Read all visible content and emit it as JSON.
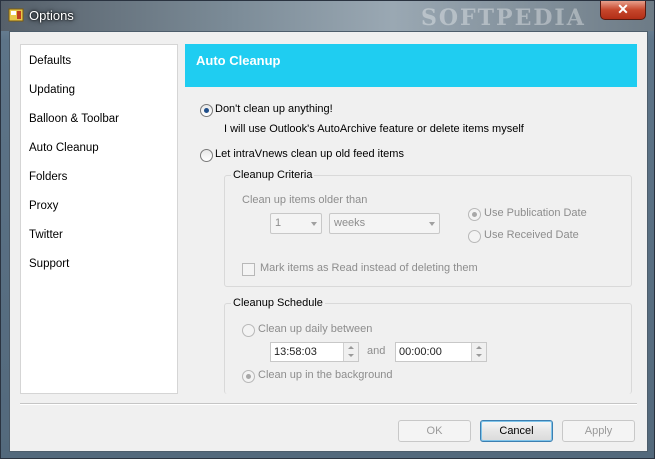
{
  "window": {
    "title": "Options",
    "watermark": "SOFTPEDIA",
    "close_glyph": "✕"
  },
  "sidebar": {
    "items": [
      {
        "label": "Defaults"
      },
      {
        "label": "Updating"
      },
      {
        "label": "Balloon & Toolbar"
      },
      {
        "label": "Auto Cleanup"
      },
      {
        "label": "Folders"
      },
      {
        "label": "Proxy"
      },
      {
        "label": "Twitter"
      },
      {
        "label": "Support"
      }
    ]
  },
  "panel": {
    "title": "Auto Cleanup",
    "header_color": "#1fcdf1",
    "options": {
      "no_cleanup_label": "Don't clean up anything!",
      "no_cleanup_desc": "I will use Outlook's AutoArchive feature or delete items myself",
      "intravnews_cleanup_label": "Let intraVnews clean up old feed items"
    },
    "criteria": {
      "title": "Cleanup Criteria",
      "older_than_label": "Clean up items older than",
      "count_value": "1",
      "unit_value": "weeks",
      "use_publication_date": "Use Publication Date",
      "use_received_date": "Use Received Date",
      "mark_as_read_label": "Mark items as Read instead of deleting them"
    },
    "schedule": {
      "title": "Cleanup Schedule",
      "daily_label": "Clean up daily between",
      "start_time": "13:58:03",
      "and_label": "and",
      "end_time": "00:00:00",
      "background_label": "Clean up in the background"
    }
  },
  "footer": {
    "ok_label": "OK",
    "cancel_label": "Cancel",
    "apply_label": "Apply"
  }
}
